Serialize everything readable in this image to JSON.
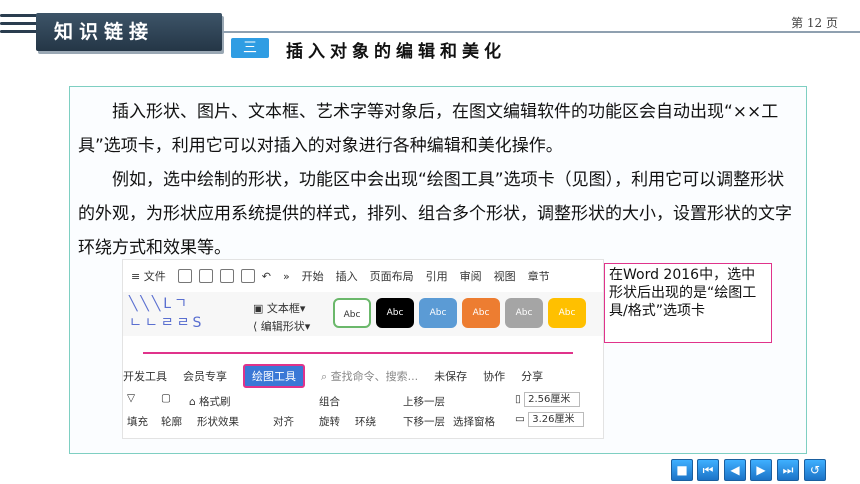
{
  "header": {
    "section_title": "知识链接",
    "page_number": "第 12 页",
    "sub_badge": "三",
    "sub_title": "插入对象的编辑和美化"
  },
  "content": {
    "paragraph1": "插入形状、图片、文本框、艺术字等对象后，在图文编辑软件的功能区会自动出现“××工具”选项卡，利用它可以对插入的对象进行各种编辑和美化操作。",
    "paragraph2": "例如，选中绘制的形状，功能区中会出现“绘图工具”选项卡（见图），利用它可以调整形状的外观，为形状应用系统提供的样式，排列、组合多个形状，调整形状的大小，设置形状的文字环绕方式和效果等。"
  },
  "screenshot": {
    "menu_items": [
      "文件",
      "开始",
      "插入",
      "页面布局",
      "引用",
      "审阅",
      "视图",
      "章节"
    ],
    "menu_more": "»",
    "textbox_label": "文本框",
    "edit_shape_label": "编辑形状",
    "style_label": "Abc",
    "style_colors": [
      "#ffffff",
      "#000000",
      "#5b9bd5",
      "#ed7d31",
      "#a5a5a5",
      "#ffc000"
    ],
    "tabs": [
      "开发工具",
      "会员专享",
      "绘图工具",
      "查找命令、搜索...",
      "未保存",
      "协作",
      "分享"
    ],
    "format_brush": "格式刷",
    "fill": "填充",
    "outline": "轮廓",
    "shape_effect": "形状效果",
    "align": "对齐",
    "group": "组合",
    "rotate": "旋转",
    "wrap": "环绕",
    "bring_forward": "上移一层",
    "send_backward": "下移一层",
    "selection_pane": "选择窗格",
    "height": "2.56厘米",
    "width": "3.26厘米"
  },
  "callout": "在Word 2016中，选中形状后出现的是“绘图工具/格式”选项卡",
  "colors": {
    "header_bg": "#2f4456",
    "badge": "#2f9de3",
    "content_border": "#7ecfc2",
    "highlight": "#e0338b",
    "nav": "#2a8ee6"
  },
  "nav_buttons": [
    "first-slide",
    "previous",
    "next",
    "last-slide",
    "return"
  ]
}
